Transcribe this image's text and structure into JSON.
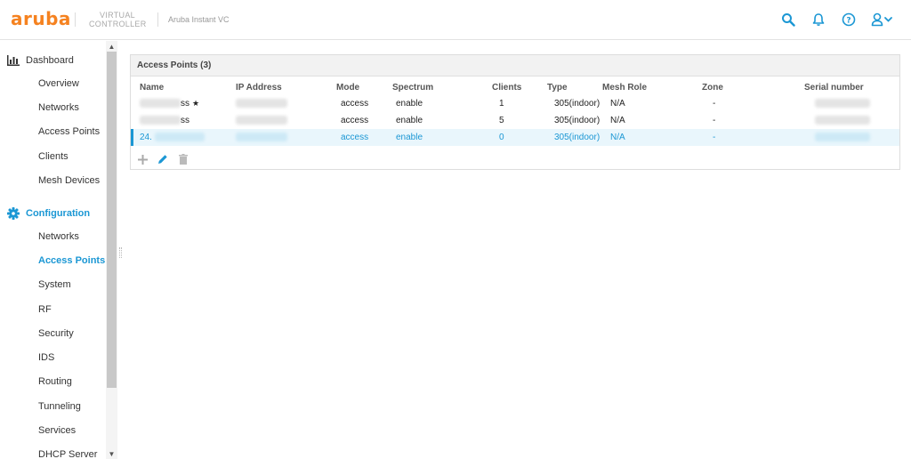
{
  "header": {
    "logo": "aruba",
    "virtual_line1": "VIRTUAL",
    "virtual_line2": "CONTROLLER",
    "vc_name": "Aruba Instant VC",
    "icons": [
      "search-icon",
      "bell-icon",
      "help-icon",
      "user-icon"
    ],
    "accent_color": "#1b97d4",
    "brand_color": "#f58220"
  },
  "sidebar": {
    "dashboard": {
      "label": "Dashboard",
      "items": [
        "Overview",
        "Networks",
        "Access Points",
        "Clients",
        "Mesh Devices"
      ]
    },
    "configuration": {
      "label": "Configuration",
      "items": [
        "Networks",
        "Access Points",
        "System",
        "RF",
        "Security",
        "IDS",
        "Routing",
        "Tunneling",
        "Services",
        "DHCP Server"
      ],
      "active_item": "Access Points"
    }
  },
  "panel": {
    "title": "Access Points (3)",
    "columns": [
      "Name",
      "IP Address",
      "Mode",
      "Spectrum",
      "Clients",
      "Type",
      "Mesh Role",
      "Zone",
      "Serial number"
    ],
    "rows": [
      {
        "name": "ss",
        "mode": "access",
        "spectrum": "enable",
        "clients": "1",
        "type": "305(indoor)",
        "mesh_role": "N/A",
        "zone": "-",
        "star": "★"
      },
      {
        "name": "ss",
        "mode": "access",
        "spectrum": "enable",
        "clients": "5",
        "type": "305(indoor)",
        "mesh_role": "N/A",
        "zone": "-"
      },
      {
        "name": "24.",
        "mode": "access",
        "spectrum": "enable",
        "clients": "0",
        "type": "305(indoor)",
        "mesh_role": "N/A",
        "zone": "-"
      }
    ],
    "toolbar": [
      "plus-icon",
      "pencil-icon",
      "trash-icon"
    ]
  }
}
